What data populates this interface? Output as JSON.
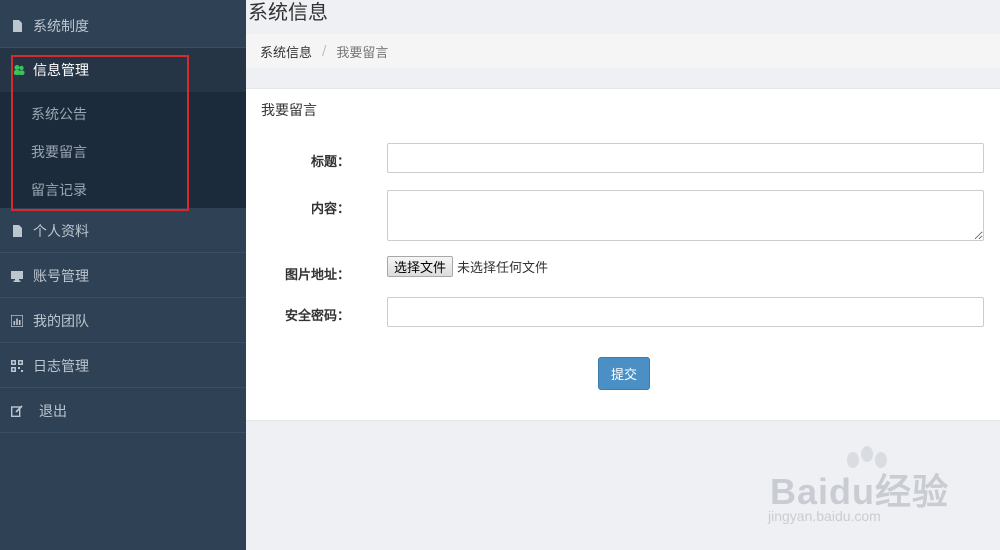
{
  "page": {
    "title": "系统信息"
  },
  "breadcrumb": {
    "items": [
      "系统信息",
      "我要留言"
    ],
    "separator": "/"
  },
  "sidebar": {
    "items": [
      {
        "label": "系统制度",
        "icon": "file-icon"
      },
      {
        "label": "信息管理",
        "icon": "users-icon",
        "active": true
      },
      {
        "label": "个人资料",
        "icon": "file-icon"
      },
      {
        "label": "账号管理",
        "icon": "monitor-icon"
      },
      {
        "label": "我的团队",
        "icon": "bar-chart-icon"
      },
      {
        "label": "日志管理",
        "icon": "qrcode-icon"
      },
      {
        "label": "退出",
        "icon": "edit-icon"
      }
    ],
    "submenu": [
      {
        "label": "系统公告"
      },
      {
        "label": "我要留言"
      },
      {
        "label": "留言记录"
      }
    ]
  },
  "form": {
    "heading": "我要留言",
    "fields": {
      "title": {
        "label": "标题：",
        "value": ""
      },
      "content": {
        "label": "内容：",
        "value": ""
      },
      "image": {
        "label": "图片地址：",
        "button": "选择文件",
        "status": "未选择任何文件"
      },
      "password": {
        "label": "安全密码：",
        "value": ""
      }
    },
    "submit_label": "提交"
  },
  "watermark": {
    "text": "Baidu经验",
    "url": "jingyan.baidu.com"
  },
  "colors": {
    "sidebar_bg": "#2f4155",
    "submenu_bg": "#1c2b3b",
    "active_bg": "#253546",
    "primary_button": "#4a90c4",
    "highlight_border": "#d42b2b",
    "active_icon": "#39c15a"
  }
}
